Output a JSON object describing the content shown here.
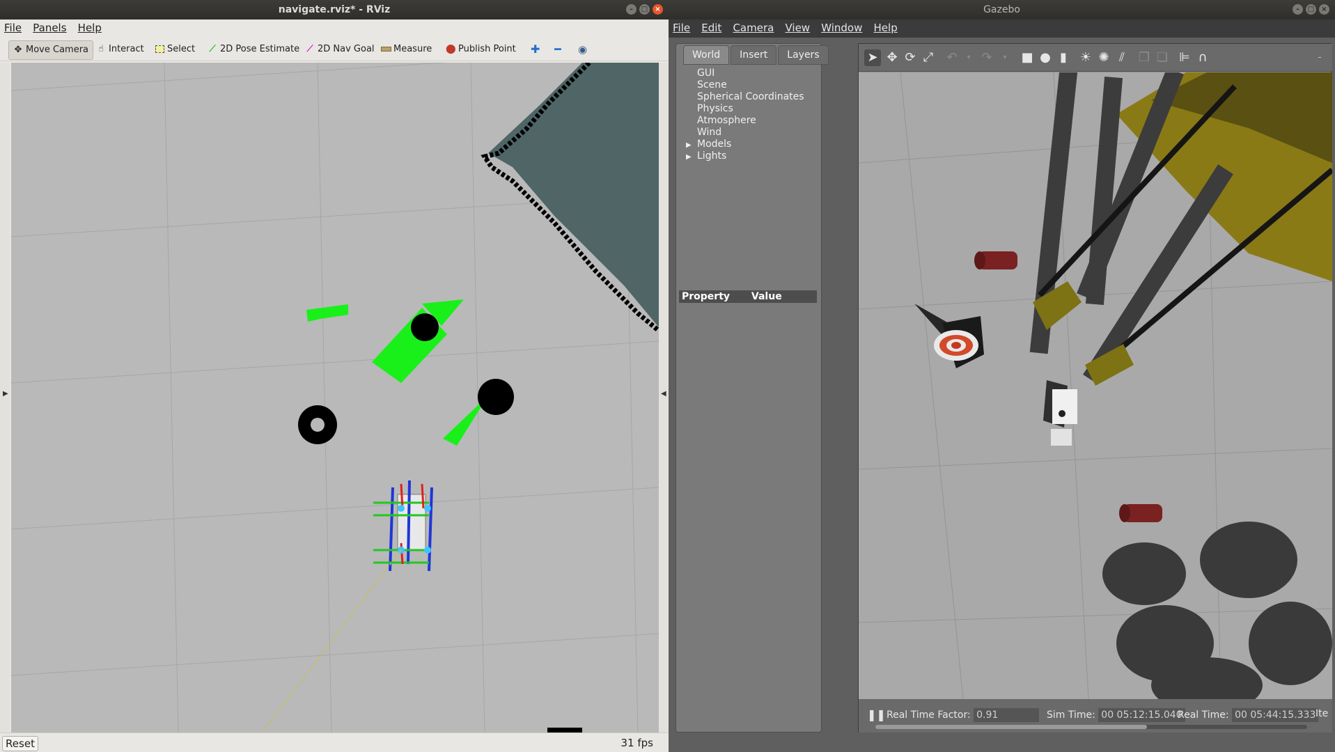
{
  "rviz": {
    "window_title": "navigate.rviz* - RViz",
    "menu": [
      "File",
      "Panels",
      "Help"
    ],
    "tools": [
      {
        "label": "Move Camera",
        "icon": "move-camera-icon",
        "active": true
      },
      {
        "label": "Interact",
        "icon": "hand-icon"
      },
      {
        "label": "Select",
        "icon": "select-box-icon"
      },
      {
        "label": "2D Pose Estimate",
        "icon": "green-arrow-icon",
        "color": "#1fbf1f"
      },
      {
        "label": "2D Nav Goal",
        "icon": "magenta-arrow-icon",
        "color": "#d81bd8"
      },
      {
        "label": "Measure",
        "icon": "ruler-icon"
      },
      {
        "label": "Publish Point",
        "icon": "map-pin-icon",
        "color": "#c0392b"
      }
    ],
    "view_tool_icons": [
      "plus-icon",
      "minus-icon",
      "eye-icon"
    ],
    "reset_label": "Reset",
    "fps": "31 fps",
    "colors": {
      "grid_bg": "#b9b9b9",
      "map_unknown": "#4f6566",
      "obstacle": "#000000",
      "laser": "#00ff00"
    }
  },
  "gazebo": {
    "window_title": "Gazebo",
    "menu": [
      "File",
      "Edit",
      "Camera",
      "View",
      "Window",
      "Help"
    ],
    "tabs": [
      "World",
      "Insert",
      "Layers"
    ],
    "active_tab": "World",
    "tree": [
      {
        "label": "GUI",
        "expandable": false
      },
      {
        "label": "Scene",
        "expandable": false
      },
      {
        "label": "Spherical Coordinates",
        "expandable": false
      },
      {
        "label": "Physics",
        "expandable": false
      },
      {
        "label": "Atmosphere",
        "expandable": false
      },
      {
        "label": "Wind",
        "expandable": false
      },
      {
        "label": "Models",
        "expandable": true
      },
      {
        "label": "Lights",
        "expandable": true
      }
    ],
    "property_header": {
      "property": "Property",
      "value": "Value"
    },
    "status": {
      "real_time_factor_label": "Real Time Factor:",
      "real_time_factor": "0.91",
      "sim_time_label": "Sim Time:",
      "sim_time": "00 05:12:15.040",
      "real_time_label": "Real Time:",
      "real_time": "00 05:44:15.333",
      "iterations_label": "Ite"
    }
  }
}
